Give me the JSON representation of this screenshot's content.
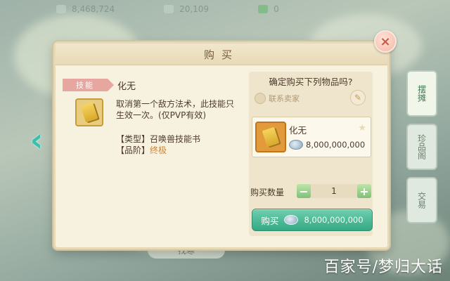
{
  "topbar": {
    "currency_1": "8,468,724",
    "currency_2": "20,109",
    "currency_3": "0"
  },
  "side_tabs": [
    "摆摊",
    "珍品阁",
    "交易"
  ],
  "background": {
    "bottom_button": "找寒"
  },
  "dialog": {
    "title": "购买",
    "close_symbol": "×",
    "item": {
      "category": "技能",
      "name": "化无",
      "description": "取消第一个敌方法术，此技能只生效一次。(仅PVP有效)",
      "type_line": "【类型】召唤兽技能书",
      "quality_label": "【品阶】",
      "quality_value": "终极"
    },
    "purchase": {
      "confirm_text": "确定购买下列物品吗?",
      "contact_seller": "联系卖家",
      "card_name": "化无",
      "card_price": "8,000,000,000",
      "qty_label": "购买数量",
      "qty_value": "1",
      "minus": "−",
      "plus": "+",
      "buy_label": "购买",
      "buy_price": "8,000,000,000"
    }
  },
  "watermark": "百家号/梦归大话"
}
